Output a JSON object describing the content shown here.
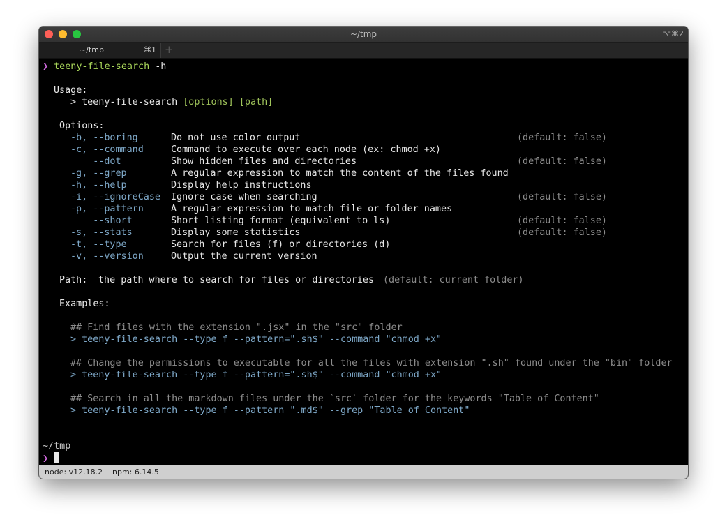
{
  "window": {
    "title": "~/tmp",
    "shortcut": "⌥⌘2"
  },
  "tab": {
    "label": "~/tmp",
    "shortcut": "⌘1",
    "add": "+"
  },
  "terminal": {
    "prompt_symbol": "❯",
    "command": "teeny-file-search",
    "command_arg": "-h",
    "usage_heading": "Usage:",
    "usage_prefix": "> ",
    "usage_cmd": "teeny-file-search",
    "usage_args": "[options] [path]",
    "options_heading": "Options:",
    "options": [
      {
        "flag": "-b, --boring",
        "desc": "Do not use color output",
        "default": "(default: false)"
      },
      {
        "flag": "-c, --command",
        "desc": "Command to execute over each node (ex: chmod +x)",
        "default": ""
      },
      {
        "flag": "    --dot",
        "desc": "Show hidden files and directories",
        "default": "(default: false)"
      },
      {
        "flag": "-g, --grep",
        "desc": "A regular expression to match the content of the files found",
        "default": ""
      },
      {
        "flag": "-h, --help",
        "desc": "Display help instructions",
        "default": ""
      },
      {
        "flag": "-i, --ignoreCase",
        "desc": "Ignore case when searching",
        "default": "(default: false)"
      },
      {
        "flag": "-p, --pattern",
        "desc": "A regular expression to match file or folder names",
        "default": ""
      },
      {
        "flag": "    --short",
        "desc": "Short listing format (equivalent to ls)",
        "default": "(default: false)"
      },
      {
        "flag": "-s, --stats",
        "desc": "Display some statistics",
        "default": "(default: false)"
      },
      {
        "flag": "-t, --type",
        "desc": "Search for files (f) or directories (d)",
        "default": ""
      },
      {
        "flag": "-v, --version",
        "desc": "Output the current version",
        "default": ""
      }
    ],
    "path_heading": "Path:",
    "path_desc": "the path where to search for files or directories",
    "path_default": "(default: current folder)",
    "examples_heading": "Examples:",
    "examples": [
      {
        "comment": "## Find files with the extension \".jsx\" in the \"src\" folder",
        "cmd": "> teeny-file-search --type f --pattern=\".sh$\" --command \"chmod +x\""
      },
      {
        "comment": "## Change the permissions to executable for all the files with extension \".sh\" found under the \"bin\" folder",
        "cmd": "> teeny-file-search --type f --pattern=\".sh$\" --command \"chmod +x\""
      },
      {
        "comment": "## Search in all the markdown files under the `src` folder for the keywords \"Table of Content\"",
        "cmd": "> teeny-file-search --type f --pattern \".md$\" --grep \"Table of Content\""
      }
    ],
    "cwd": "~/tmp"
  },
  "status": {
    "node": "node: v12.18.2",
    "npm": "npm: 6.14.5"
  },
  "colors": {
    "prompt": "#d36ae0",
    "command": "#a9d65a",
    "flag": "#7ea8c8",
    "muted": "#8c8c8c"
  }
}
